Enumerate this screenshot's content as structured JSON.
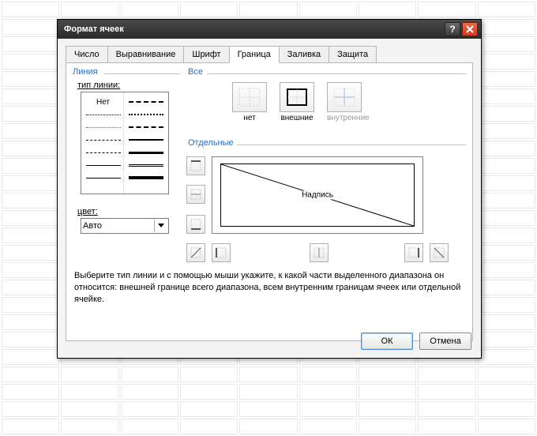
{
  "window": {
    "title": "Формат ячеек"
  },
  "tabs": [
    "Число",
    "Выравнивание",
    "Шрифт",
    "Граница",
    "Заливка",
    "Защита"
  ],
  "active_tab": 3,
  "line_section": {
    "title": "Линия",
    "type_label": "тип линии:",
    "none_label": "Нет",
    "color_label": "цвет:",
    "color_value": "Авто"
  },
  "all_section": {
    "title": "Все",
    "presets": [
      {
        "label": "нет",
        "enabled": true
      },
      {
        "label": "внешние",
        "enabled": true
      },
      {
        "label": "внутренние",
        "enabled": false
      }
    ]
  },
  "separate_section": {
    "title": "Отдельные",
    "preview_label": "Надпись"
  },
  "help_text": "Выберите тип линии и с помощью мыши укажите, к какой части выделенного диапазона он относится: внешней границе всего диапазона, всем внутренним границам ячеек или отдельной ячейке.",
  "buttons": {
    "ok": "ОК",
    "cancel": "Отмена"
  },
  "colors": {
    "accent": "#2a6dc0"
  }
}
